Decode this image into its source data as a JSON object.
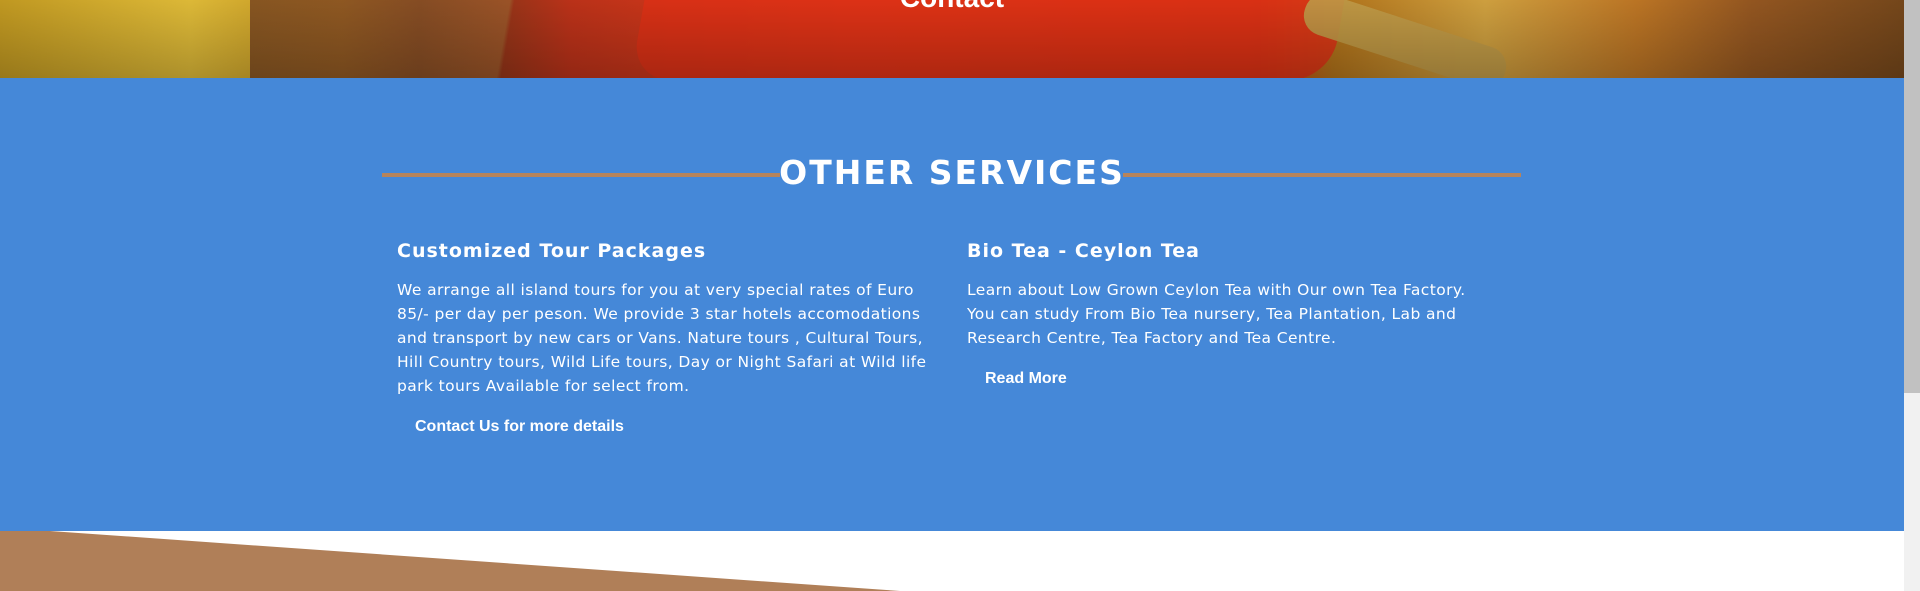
{
  "hero": {
    "title": "Contact"
  },
  "services": {
    "title": "OTHER SERVICES",
    "accent_color": "#b7845b",
    "background_color": "#4588d8",
    "cards": [
      {
        "heading": "Customized Tour Packages",
        "body": "We arrange all island tours for you at very special rates of Euro 85/- per day per peson. We provide 3 star hotels accomodations and transport by new cars or Vans. Nature tours , Cultural Tours, Hill Country tours, Wild Life tours, Day or Night Safari at Wild life park tours Available for select from.",
        "link_label": "Contact Us for more details"
      },
      {
        "heading": "Bio Tea - Ceylon Tea",
        "body": "Learn about Low Grown Ceylon Tea with Our own Tea Factory. You can study From Bio Tea nursery, Tea Plantation, Lab and Research Centre, Tea Factory and Tea Centre.",
        "link_label": "Read More"
      }
    ]
  },
  "bottom": {
    "shape_color": "#b07f58"
  }
}
